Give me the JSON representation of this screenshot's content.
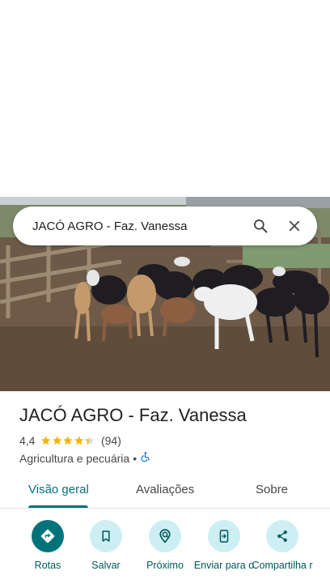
{
  "search": {
    "query": "JACÓ AGRO - Faz. Vanessa"
  },
  "place": {
    "name": "JACÓ AGRO - Faz. Vanessa",
    "rating": "4,4",
    "rating_value": 4.4,
    "review_count": "(94)",
    "category": "Agricultura e pecuária",
    "separator": "•"
  },
  "tabs": [
    {
      "label": "Visão geral",
      "active": true
    },
    {
      "label": "Avaliações",
      "active": false
    },
    {
      "label": "Sobre",
      "active": false
    }
  ],
  "actions": [
    {
      "label": "Rotas",
      "icon": "directions-icon"
    },
    {
      "label": "Salvar",
      "icon": "bookmark-icon"
    },
    {
      "label": "Próximo",
      "icon": "nearby-icon"
    },
    {
      "label": "Enviar para o",
      "icon": "send-to-phone-icon"
    },
    {
      "label": "Compartilha r",
      "icon": "share-icon"
    }
  ],
  "colors": {
    "accent": "#00737a",
    "accent_light": "#cdeff3",
    "star": "#f4b400",
    "accessibility": "#1a73e8"
  }
}
